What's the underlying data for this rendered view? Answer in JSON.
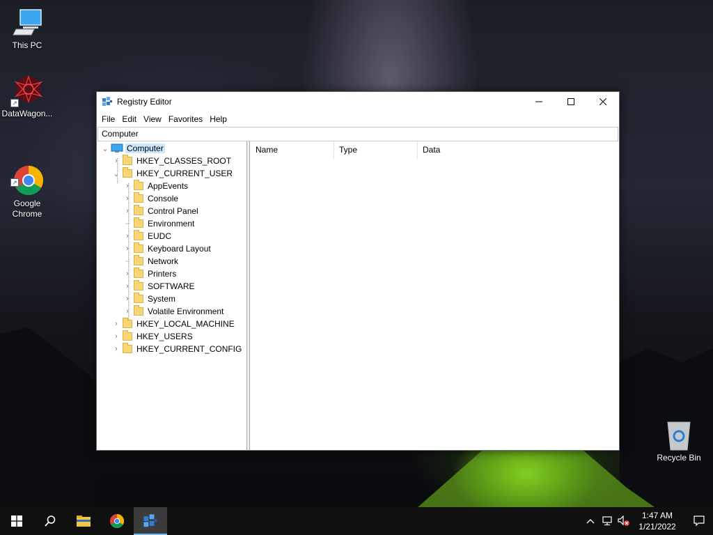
{
  "desktop": {
    "icons": [
      {
        "label": "This PC"
      },
      {
        "label": "DataWagon..."
      },
      {
        "label": "Google\nChrome"
      },
      {
        "label": "Recycle Bin"
      }
    ]
  },
  "window": {
    "title": "Registry Editor",
    "menu": [
      "File",
      "Edit",
      "View",
      "Favorites",
      "Help"
    ],
    "address": "Computer",
    "tree": {
      "root": "Computer",
      "hkey_classes_root": "HKEY_CLASSES_ROOT",
      "hkey_current_user": "HKEY_CURRENT_USER",
      "children": [
        "AppEvents",
        "Console",
        "Control Panel",
        "Environment",
        "EUDC",
        "Keyboard Layout",
        "Network",
        "Printers",
        "SOFTWARE",
        "System",
        "Volatile Environment"
      ],
      "hkey_local_machine": "HKEY_LOCAL_MACHINE",
      "hkey_users": "HKEY_USERS",
      "hkey_current_config": "HKEY_CURRENT_CONFIG"
    },
    "columns": [
      "Name",
      "Type",
      "Data"
    ]
  },
  "taskbar": {
    "time": "1:47 AM",
    "date": "1/21/2022",
    "accent": "#76b9ed"
  }
}
